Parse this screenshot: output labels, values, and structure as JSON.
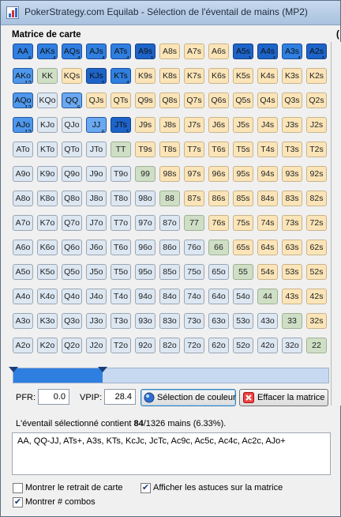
{
  "window": {
    "title": "PokerStrategy.com Equilab - Sélection de l'éventail de mains (MP2)"
  },
  "matrix": {
    "label": "Matrice de carte",
    "right_fragment": "(",
    "cells": [
      [
        {
          "t": "AA",
          "n": "6",
          "s": "sel"
        },
        {
          "t": "AKs",
          "n": "4",
          "s": "sel"
        },
        {
          "t": "AQs",
          "n": "4",
          "s": "sel"
        },
        {
          "t": "AJs",
          "n": "4",
          "s": "sel"
        },
        {
          "t": "ATs",
          "n": "4",
          "s": "sel"
        },
        {
          "t": "A9s",
          "n": "1",
          "s": "sel-s"
        },
        {
          "t": "A8s",
          "s": "s"
        },
        {
          "t": "A7s",
          "s": "s"
        },
        {
          "t": "A6s",
          "s": "s"
        },
        {
          "t": "A5s",
          "n": "1",
          "s": "sel-s"
        },
        {
          "t": "A4s",
          "n": "1",
          "s": "sel-s"
        },
        {
          "t": "A3s",
          "n": "4",
          "s": "sel"
        },
        {
          "t": "A2s",
          "n": "1",
          "s": "sel-s"
        }
      ],
      [
        {
          "t": "AKo",
          "n": "12",
          "s": "sel-o"
        },
        {
          "t": "KK",
          "s": "p"
        },
        {
          "t": "KQs",
          "s": "s"
        },
        {
          "t": "KJs",
          "n": "1",
          "s": "sel-s"
        },
        {
          "t": "KTs",
          "n": "4",
          "s": "sel"
        },
        {
          "t": "K9s",
          "s": "s"
        },
        {
          "t": "K8s",
          "s": "s"
        },
        {
          "t": "K7s",
          "s": "s"
        },
        {
          "t": "K6s",
          "s": "s"
        },
        {
          "t": "K5s",
          "s": "s"
        },
        {
          "t": "K4s",
          "s": "s"
        },
        {
          "t": "K3s",
          "s": "s"
        },
        {
          "t": "K2s",
          "s": "s"
        }
      ],
      [
        {
          "t": "AQo",
          "n": "12",
          "s": "sel-o"
        },
        {
          "t": "KQo",
          "s": "o"
        },
        {
          "t": "QQ",
          "n": "6",
          "s": "sel-p"
        },
        {
          "t": "QJs",
          "s": "s"
        },
        {
          "t": "QTs",
          "s": "s"
        },
        {
          "t": "Q9s",
          "s": "s"
        },
        {
          "t": "Q8s",
          "s": "s"
        },
        {
          "t": "Q7s",
          "s": "s"
        },
        {
          "t": "Q6s",
          "s": "s"
        },
        {
          "t": "Q5s",
          "s": "s"
        },
        {
          "t": "Q4s",
          "s": "s"
        },
        {
          "t": "Q3s",
          "s": "s"
        },
        {
          "t": "Q2s",
          "s": "s"
        }
      ],
      [
        {
          "t": "AJo",
          "n": "12",
          "s": "sel-o"
        },
        {
          "t": "KJo",
          "s": "o"
        },
        {
          "t": "QJo",
          "s": "o"
        },
        {
          "t": "JJ",
          "n": "6",
          "s": "sel-p"
        },
        {
          "t": "JTs",
          "n": "1",
          "s": "sel-s"
        },
        {
          "t": "J9s",
          "s": "s"
        },
        {
          "t": "J8s",
          "s": "s"
        },
        {
          "t": "J7s",
          "s": "s"
        },
        {
          "t": "J6s",
          "s": "s"
        },
        {
          "t": "J5s",
          "s": "s"
        },
        {
          "t": "J4s",
          "s": "s"
        },
        {
          "t": "J3s",
          "s": "s"
        },
        {
          "t": "J2s",
          "s": "s"
        }
      ],
      [
        {
          "t": "ATo",
          "s": "o"
        },
        {
          "t": "KTo",
          "s": "o"
        },
        {
          "t": "QTo",
          "s": "o"
        },
        {
          "t": "JTo",
          "s": "o"
        },
        {
          "t": "TT",
          "s": "p"
        },
        {
          "t": "T9s",
          "s": "s"
        },
        {
          "t": "T8s",
          "s": "s"
        },
        {
          "t": "T7s",
          "s": "s"
        },
        {
          "t": "T6s",
          "s": "s"
        },
        {
          "t": "T5s",
          "s": "s"
        },
        {
          "t": "T4s",
          "s": "s"
        },
        {
          "t": "T3s",
          "s": "s"
        },
        {
          "t": "T2s",
          "s": "s"
        }
      ],
      [
        {
          "t": "A9o",
          "s": "o"
        },
        {
          "t": "K9o",
          "s": "o"
        },
        {
          "t": "Q9o",
          "s": "o"
        },
        {
          "t": "J9o",
          "s": "o"
        },
        {
          "t": "T9o",
          "s": "o"
        },
        {
          "t": "99",
          "s": "p"
        },
        {
          "t": "98s",
          "s": "s"
        },
        {
          "t": "97s",
          "s": "s"
        },
        {
          "t": "96s",
          "s": "s"
        },
        {
          "t": "95s",
          "s": "s"
        },
        {
          "t": "94s",
          "s": "s"
        },
        {
          "t": "93s",
          "s": "s"
        },
        {
          "t": "92s",
          "s": "s"
        }
      ],
      [
        {
          "t": "A8o",
          "s": "o"
        },
        {
          "t": "K8o",
          "s": "o"
        },
        {
          "t": "Q8o",
          "s": "o"
        },
        {
          "t": "J8o",
          "s": "o"
        },
        {
          "t": "T8o",
          "s": "o"
        },
        {
          "t": "98o",
          "s": "o"
        },
        {
          "t": "88",
          "s": "p"
        },
        {
          "t": "87s",
          "s": "s"
        },
        {
          "t": "86s",
          "s": "s"
        },
        {
          "t": "85s",
          "s": "s"
        },
        {
          "t": "84s",
          "s": "s"
        },
        {
          "t": "83s",
          "s": "s"
        },
        {
          "t": "82s",
          "s": "s"
        }
      ],
      [
        {
          "t": "A7o",
          "s": "o"
        },
        {
          "t": "K7o",
          "s": "o"
        },
        {
          "t": "Q7o",
          "s": "o"
        },
        {
          "t": "J7o",
          "s": "o"
        },
        {
          "t": "T7o",
          "s": "o"
        },
        {
          "t": "97o",
          "s": "o"
        },
        {
          "t": "87o",
          "s": "o"
        },
        {
          "t": "77",
          "s": "p"
        },
        {
          "t": "76s",
          "s": "s"
        },
        {
          "t": "75s",
          "s": "s"
        },
        {
          "t": "74s",
          "s": "s"
        },
        {
          "t": "73s",
          "s": "s"
        },
        {
          "t": "72s",
          "s": "s"
        }
      ],
      [
        {
          "t": "A6o",
          "s": "o"
        },
        {
          "t": "K6o",
          "s": "o"
        },
        {
          "t": "Q6o",
          "s": "o"
        },
        {
          "t": "J6o",
          "s": "o"
        },
        {
          "t": "T6o",
          "s": "o"
        },
        {
          "t": "96o",
          "s": "o"
        },
        {
          "t": "86o",
          "s": "o"
        },
        {
          "t": "76o",
          "s": "o"
        },
        {
          "t": "66",
          "s": "p"
        },
        {
          "t": "65s",
          "s": "s"
        },
        {
          "t": "64s",
          "s": "s"
        },
        {
          "t": "63s",
          "s": "s"
        },
        {
          "t": "62s",
          "s": "s"
        }
      ],
      [
        {
          "t": "A5o",
          "s": "o"
        },
        {
          "t": "K5o",
          "s": "o"
        },
        {
          "t": "Q5o",
          "s": "o"
        },
        {
          "t": "J5o",
          "s": "o"
        },
        {
          "t": "T5o",
          "s": "o"
        },
        {
          "t": "95o",
          "s": "o"
        },
        {
          "t": "85o",
          "s": "o"
        },
        {
          "t": "75o",
          "s": "o"
        },
        {
          "t": "65o",
          "s": "o"
        },
        {
          "t": "55",
          "s": "p"
        },
        {
          "t": "54s",
          "s": "s"
        },
        {
          "t": "53s",
          "s": "s"
        },
        {
          "t": "52s",
          "s": "s"
        }
      ],
      [
        {
          "t": "A4o",
          "s": "o"
        },
        {
          "t": "K4o",
          "s": "o"
        },
        {
          "t": "Q4o",
          "s": "o"
        },
        {
          "t": "J4o",
          "s": "o"
        },
        {
          "t": "T4o",
          "s": "o"
        },
        {
          "t": "94o",
          "s": "o"
        },
        {
          "t": "84o",
          "s": "o"
        },
        {
          "t": "74o",
          "s": "o"
        },
        {
          "t": "64o",
          "s": "o"
        },
        {
          "t": "54o",
          "s": "o"
        },
        {
          "t": "44",
          "s": "p"
        },
        {
          "t": "43s",
          "s": "s"
        },
        {
          "t": "42s",
          "s": "s"
        }
      ],
      [
        {
          "t": "A3o",
          "s": "o"
        },
        {
          "t": "K3o",
          "s": "o"
        },
        {
          "t": "Q3o",
          "s": "o"
        },
        {
          "t": "J3o",
          "s": "o"
        },
        {
          "t": "T3o",
          "s": "o"
        },
        {
          "t": "93o",
          "s": "o"
        },
        {
          "t": "83o",
          "s": "o"
        },
        {
          "t": "73o",
          "s": "o"
        },
        {
          "t": "63o",
          "s": "o"
        },
        {
          "t": "53o",
          "s": "o"
        },
        {
          "t": "43o",
          "s": "o"
        },
        {
          "t": "33",
          "s": "p"
        },
        {
          "t": "32s",
          "s": "s"
        }
      ],
      [
        {
          "t": "A2o",
          "s": "o"
        },
        {
          "t": "K2o",
          "s": "o"
        },
        {
          "t": "Q2o",
          "s": "o"
        },
        {
          "t": "J2o",
          "s": "o"
        },
        {
          "t": "T2o",
          "s": "o"
        },
        {
          "t": "92o",
          "s": "o"
        },
        {
          "t": "82o",
          "s": "o"
        },
        {
          "t": "72o",
          "s": "o"
        },
        {
          "t": "62o",
          "s": "o"
        },
        {
          "t": "52o",
          "s": "o"
        },
        {
          "t": "42o",
          "s": "o"
        },
        {
          "t": "32o",
          "s": "o"
        },
        {
          "t": "22",
          "s": "p"
        }
      ]
    ]
  },
  "slider": {
    "selected_fraction": 0.284
  },
  "controls": {
    "pfr_label": "PFR:",
    "pfr_value": "0.0",
    "vpip_label": "VPIP:",
    "vpip_value": "28.4",
    "color_button": "Sélection de couleur",
    "clear_button": "Effacer la matrice"
  },
  "summary": {
    "prefix": "L'éventail sélectionné contient ",
    "count": "84",
    "suffix": "/1326 mains (6.33%)."
  },
  "range_text": "AA, QQ-JJ, ATs+, A3s, KTs, KcJc, JcTc, Ac9c, Ac5c, Ac4c, Ac2c, AJo+",
  "options": {
    "show_card_removal": {
      "label": "Montrer le retrait de carte",
      "checked": false
    },
    "show_tips": {
      "label": "Afficher les astuces sur la matrice",
      "checked": true
    },
    "show_combos": {
      "label": "Montrer # combos",
      "checked": true
    }
  },
  "icons": {
    "app": "chart-app-icon",
    "color": "color-wheel-icon",
    "clear": "red-x-icon"
  }
}
